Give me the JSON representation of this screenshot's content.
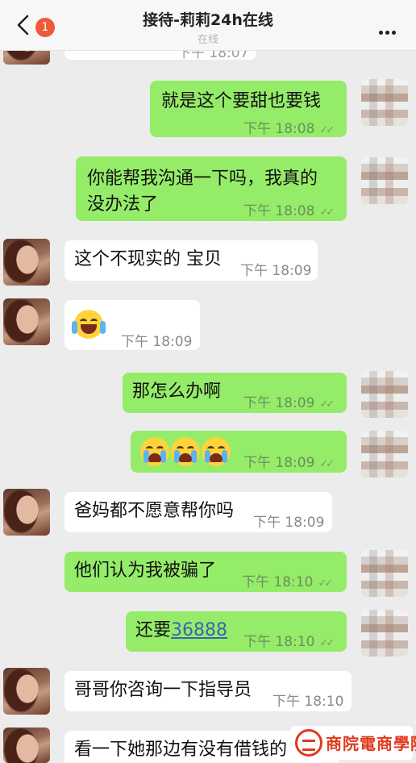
{
  "header": {
    "title": "接待-莉莉24h在线",
    "subtitle": "在线",
    "unread_count": "1"
  },
  "messages": [
    {
      "side": "out",
      "text": "就是这个要甜也要钱",
      "time": "下午 18:08"
    },
    {
      "side": "out",
      "text": "你能帮我沟通一下吗，我真的没办法了",
      "time": "下午 18:08"
    },
    {
      "side": "in",
      "text": "这个不现实的 宝贝",
      "time": "下午 18:09"
    },
    {
      "side": "in",
      "emoji": "laughing-crying-emoji",
      "time": "下午 18:09"
    },
    {
      "side": "out",
      "text": "那怎么办啊",
      "time": "下午 18:09"
    },
    {
      "side": "out",
      "emoji": "crying-emoji x3",
      "time": "下午 18:09"
    },
    {
      "side": "in",
      "text": "爸妈都不愿意帮你吗",
      "time": "下午 18:09"
    },
    {
      "side": "out",
      "text": "他们认为我被骗了",
      "time": "下午 18:10"
    },
    {
      "side": "out",
      "text_prefix": "还要",
      "link": "36888",
      "time": "下午 18:10"
    },
    {
      "side": "in",
      "text": "哥哥你咨询一下指导员",
      "time": "下午 18:10"
    },
    {
      "side": "in",
      "text": "看一下她那边有没有借钱的"
    }
  ],
  "top_partial": {
    "time": "下午 18:07"
  },
  "watermark": {
    "text": "商院電商學院"
  },
  "colors": {
    "out_bubble": "#95ec69",
    "in_bubble": "#ffffff",
    "badge": "#ee5a3a",
    "link": "#3c64b4"
  }
}
